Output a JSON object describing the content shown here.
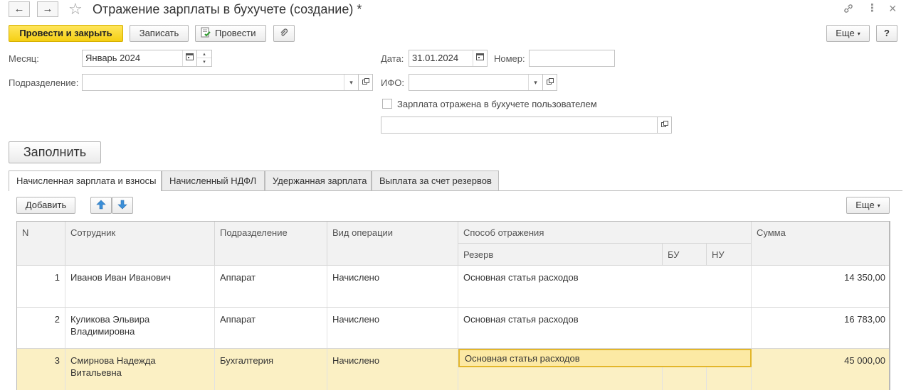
{
  "window": {
    "title": "Отражение зарплаты в бухучете (создание) *",
    "nav_back_icon": "←",
    "nav_forward_icon": "→",
    "favorite_icon": "☆",
    "link_icon": "🔗",
    "menu_icon": "⋮",
    "close_icon": "×"
  },
  "toolbar": {
    "post_close_label": "Провести и закрыть",
    "save_label": "Записать",
    "post_label": "Провести",
    "attach_icon": "📎",
    "more_label": "Еще",
    "help_label": "?"
  },
  "form": {
    "month_label": "Месяц:",
    "month_value": "Январь 2024",
    "date_label": "Дата:",
    "date_value": "31.01.2024",
    "number_label": "Номер:",
    "number_value": "",
    "department_label": "Подразделение:",
    "department_value": "",
    "ifo_label": "ИФО:",
    "ifo_value": "",
    "reflected_checkbox_label": "Зарплата отражена в бухучете пользователем",
    "reflected_checked": false,
    "reflected_note_value": "",
    "fill_button_label": "Заполнить"
  },
  "tabs": [
    {
      "label": "Начисленная зарплата и взносы",
      "active": true
    },
    {
      "label": "Начисленный НДФЛ",
      "active": false
    },
    {
      "label": "Удержанная зарплата",
      "active": false
    },
    {
      "label": "Выплата за счет резервов",
      "active": false
    }
  ],
  "table_toolbar": {
    "add_label": "Добавить",
    "up_icon": "🡅",
    "down_icon": "🡇",
    "more_label": "Еще"
  },
  "table": {
    "headers": {
      "n": "N",
      "employee": "Сотрудник",
      "department": "Подразделение",
      "operation": "Вид операции",
      "method": "Способ отражения",
      "reserve": "Резерв",
      "bu": "БУ",
      "nu": "НУ",
      "sum": "Сумма"
    },
    "rows": [
      {
        "n": "1",
        "employee": "Иванов Иван Иванович",
        "department": "Аппарат",
        "operation": "Начислено",
        "method": "Основная статья расходов",
        "sum": "14 350,00"
      },
      {
        "n": "2",
        "employee": "Куликова Эльвира Владимировна",
        "department": "Аппарат",
        "operation": "Начислено",
        "method": "Основная статья расходов",
        "sum": "16 783,00"
      },
      {
        "n": "3",
        "employee": "Смирнова Надежда Витальевна",
        "department": "Бухгалтерия",
        "operation": "Начислено",
        "method": "Основная статья расходов",
        "sum": "45 000,00"
      }
    ]
  },
  "colors": {
    "primary_button": "#f5cf13",
    "selected_row": "#fbf0c4",
    "current_cell_border": "#e3b62a"
  }
}
